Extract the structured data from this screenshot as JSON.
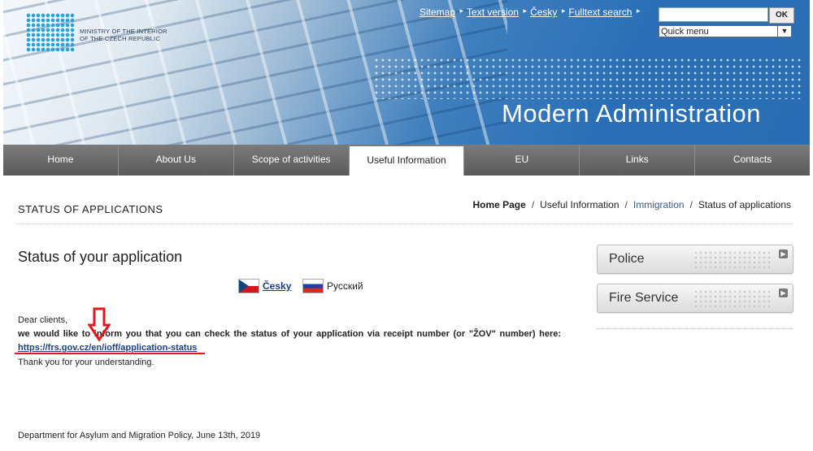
{
  "header": {
    "logo_text_line1": "MINISTRY OF THE INTERIOR",
    "logo_text_line2": "OF THE CZECH REPUBLIC",
    "slogan": "Modern Administration",
    "top_links": [
      "Sitemap",
      "Text version",
      "Česky",
      "Fulltext search"
    ],
    "search_value": "",
    "ok_label": "OK",
    "quick_menu": "Quick menu"
  },
  "nav": {
    "items": [
      "Home",
      "About Us",
      "Scope of activities",
      "Useful Information",
      "EU",
      "Links",
      "Contacts"
    ],
    "active": "Useful Information"
  },
  "page": {
    "heading": "STATUS OF APPLICATIONS",
    "breadcrumb": [
      "Home Page",
      "Useful Information",
      "Immigration",
      "Status of applications"
    ],
    "title": "Status of your application",
    "lang_cz": "Česky",
    "lang_ru": "Русский",
    "greeting": "Dear clients,",
    "message": "we would like to inform you that you can check the status of your application via receipt number (or \"ŽOV\" number) here:",
    "link": "https://frs.gov.cz/en/ioff/application-status",
    "thanks": "Thank you for your understanding.",
    "footer": "Department for Asylum and Migration Policy, June 13th, 2019"
  },
  "sidebar": {
    "buttons": [
      "Police",
      "Fire Service"
    ]
  },
  "colors": {
    "banner_blue": "#2a6db4",
    "nav_gray": "#6a6a6a",
    "link_blue": "#1a3f86",
    "annotation_red": "#e0191f"
  }
}
